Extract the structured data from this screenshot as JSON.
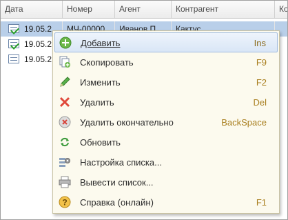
{
  "columns": [
    "Дата",
    "Номер",
    "Агент",
    "Контрагент",
    "Ко"
  ],
  "rows": [
    {
      "date": "19.05.2",
      "number": "МЧ-00000",
      "agent": "Иванов П.",
      "contractor": "Кактус",
      "status": "posted",
      "selected": true
    },
    {
      "date": "19.05.2",
      "number": "",
      "agent": "",
      "contractor": "",
      "status": "posted",
      "selected": false
    },
    {
      "date": "19.05.2",
      "number": "",
      "agent": "",
      "contractor": "",
      "status": "draft",
      "selected": false
    }
  ],
  "context_menu": {
    "items": [
      {
        "label": "Добавить",
        "shortcut": "Ins",
        "icon": "add-icon"
      },
      {
        "label": "Скопировать",
        "shortcut": "F9",
        "icon": "copy-icon"
      },
      {
        "label": "Изменить",
        "shortcut": "F2",
        "icon": "edit-icon"
      },
      {
        "label": "Удалить",
        "shortcut": "Del",
        "icon": "delete-icon"
      },
      {
        "label": "Удалить окончательно",
        "shortcut": "BackSpace",
        "icon": "delete-permanent-icon"
      },
      {
        "label": "Обновить",
        "shortcut": "",
        "icon": "refresh-icon"
      },
      {
        "label": "Настройка списка...",
        "shortcut": "",
        "icon": "list-settings-icon"
      },
      {
        "label": "Вывести список...",
        "shortcut": "",
        "icon": "print-list-icon"
      },
      {
        "label": "Справка (онлайн)",
        "shortcut": "F1",
        "icon": "help-icon"
      }
    ]
  },
  "colors": {
    "selection": "#b9cfe9",
    "shortcut": "#a87e1e",
    "menu_bg": "#fcfaee"
  }
}
